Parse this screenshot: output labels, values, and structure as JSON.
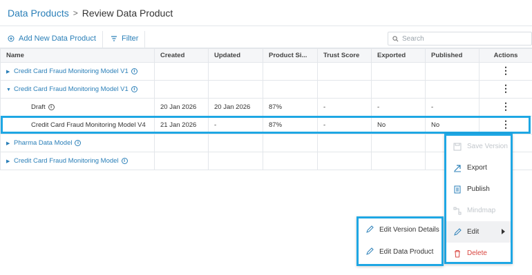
{
  "breadcrumb": {
    "parent": "Data Products",
    "separator": ">",
    "current": "Review Data Product"
  },
  "toolbar": {
    "add_label": "Add New Data Product",
    "filter_label": "Filter",
    "search_placeholder": "Search"
  },
  "table": {
    "columns": [
      "Name",
      "Created",
      "Updated",
      "Product Si...",
      "Trust Score",
      "Exported",
      "Published",
      "Actions"
    ],
    "rows": [
      {
        "name": "Credit Card Fraud Monitoring Model V1",
        "created": "",
        "updated": "",
        "size": "",
        "trust": "",
        "exported": "",
        "published": ""
      },
      {
        "name": "Credit Card Fraud Monitoring Model V1",
        "created": "",
        "updated": "",
        "size": "",
        "trust": "",
        "exported": "",
        "published": ""
      },
      {
        "name": "Draft",
        "created": "20 Jan 2026",
        "updated": "20 Jan 2026",
        "size": "87%",
        "trust": "-",
        "exported": "-",
        "published": "-"
      },
      {
        "name": "Credit Card Fraud Monitoring Model V4",
        "created": "21 Jan 2026",
        "updated": "-",
        "size": "87%",
        "trust": "-",
        "exported": "No",
        "published": "No"
      },
      {
        "name": "Pharma Data Model",
        "created": "",
        "updated": "",
        "size": "",
        "trust": "",
        "exported": "",
        "published": ""
      },
      {
        "name": "Credit Card Fraud Monitoring Model",
        "created": "",
        "updated": "",
        "size": "",
        "trust": "",
        "exported": "",
        "published": ""
      }
    ]
  },
  "actions_menu": {
    "items": [
      "Save Version",
      "Export",
      "Publish",
      "Mindmap",
      "Edit",
      "Delete"
    ]
  },
  "edit_submenu": {
    "items": [
      "Edit Version Details",
      "Edit Data Product"
    ]
  },
  "colors": {
    "accent": "#2a7fb8",
    "highlight": "#1ea7e4",
    "danger": "#d9453f"
  }
}
